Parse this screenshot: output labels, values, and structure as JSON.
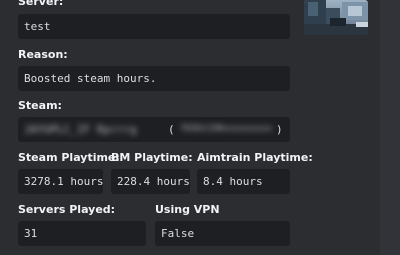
{
  "fields": {
    "server": {
      "label": "Server:",
      "value": "test"
    },
    "reason": {
      "label": "Reason:",
      "value": "Boosted steam hours."
    },
    "steam": {
      "label": "Steam:",
      "value_open_paren": "(",
      "value_close_paren": ")",
      "redacted_name": "JAYUPLC_IF Rprrrg",
      "redacted_id": "76561198xxxxxxxxx"
    },
    "steam_playtime": {
      "label": "Steam Playtime:",
      "value": "3278.1 hours"
    },
    "bm_playtime": {
      "label": "BM Playtime:",
      "value": "228.4 hours"
    },
    "aimtrain_playtime": {
      "label": "Aimtrain Playtime:",
      "value": "8.4 hours"
    },
    "servers_played": {
      "label": "Servers Played:",
      "value": "31"
    },
    "using_vpn": {
      "label": "Using VPN",
      "value": "False"
    }
  },
  "colors": {
    "background": "#2b2d31",
    "code_block": "#1e1f22",
    "label_text": "#f2f3f5",
    "value_text": "#dbdee1"
  }
}
